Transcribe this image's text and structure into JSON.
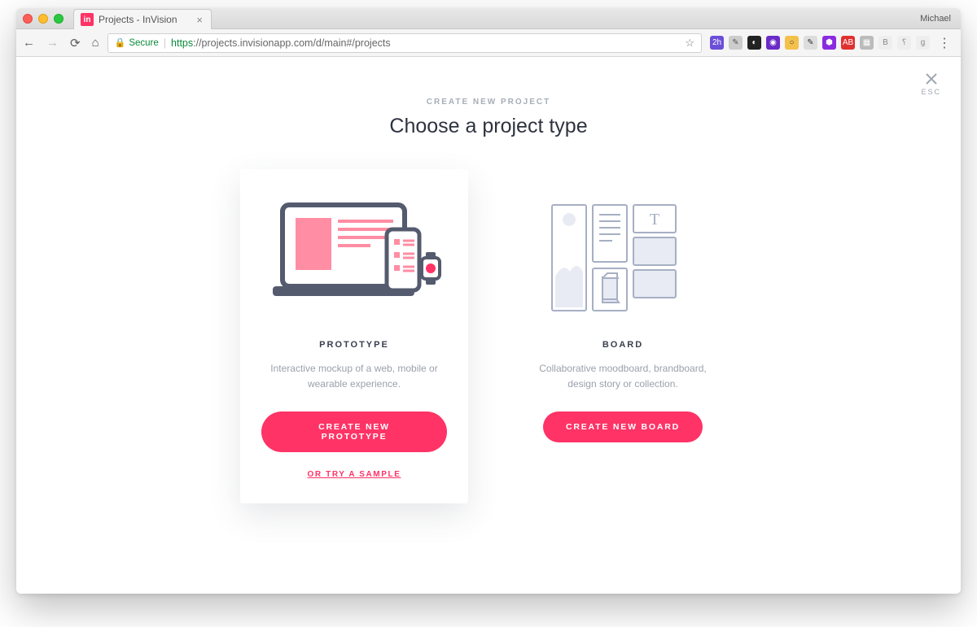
{
  "browser": {
    "tab_title": "Projects - InVision",
    "user_label": "Michael",
    "secure_label": "Secure",
    "url_scheme": "https",
    "url_host": "://projects.invisionapp.com",
    "url_path": "/d/main#/projects"
  },
  "modal": {
    "close_label": "ESC",
    "eyebrow": "CREATE NEW PROJECT",
    "title": "Choose a project type"
  },
  "cards": {
    "prototype": {
      "title": "PROTOTYPE",
      "desc": "Interactive mockup of a web, mobile or wearable experience.",
      "button": "CREATE NEW PROTOTYPE",
      "sample": "OR TRY A SAMPLE"
    },
    "board": {
      "title": "BOARD",
      "desc": "Collaborative moodboard, brandboard, design story or collection.",
      "button": "CREATE NEW BOARD"
    }
  }
}
